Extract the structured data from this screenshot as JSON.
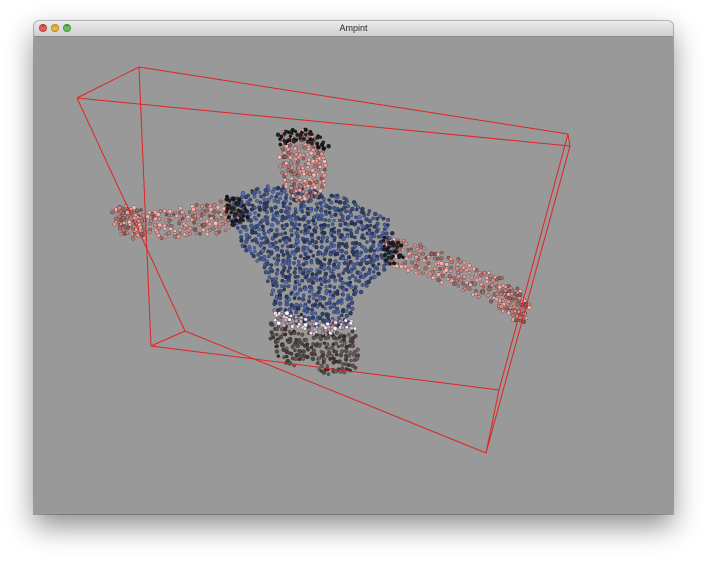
{
  "window": {
    "title": "Ampint",
    "buttons": [
      {
        "name": "close",
        "color": "#ec5a55",
        "glyph": "×"
      },
      {
        "name": "minimize",
        "color": "#f0b73b",
        "glyph": "–"
      },
      {
        "name": "maximize",
        "color": "#62c655",
        "glyph": "+"
      }
    ]
  },
  "scene": {
    "background": "#999999",
    "bounding_box_color": "#e02424",
    "point_cloud_colors": {
      "shirt": "#3e5590",
      "skin": "#e6928c",
      "hair": "#1e1e1e",
      "belt": "#e8c9d6",
      "pants": "#5b4e48"
    }
  }
}
